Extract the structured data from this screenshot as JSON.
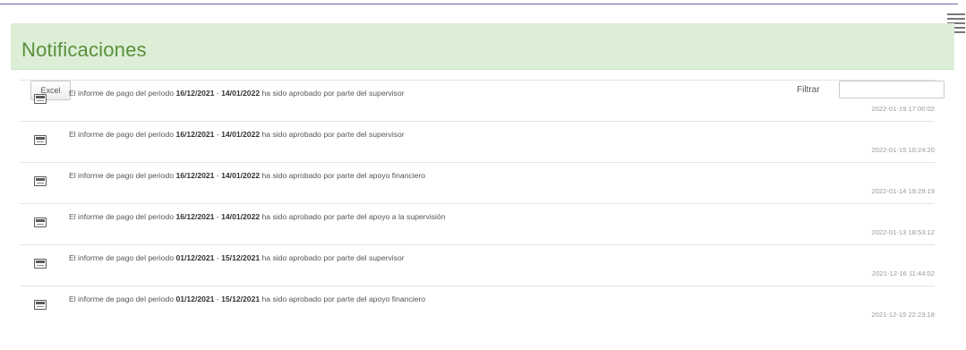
{
  "header": {
    "title": "Notificaciones",
    "menu_icon": "hamburger-menu-icon"
  },
  "toolbar": {
    "excel_label": "Excel",
    "filter_label": "Filtrar",
    "filter_value": ""
  },
  "notifications": [
    {
      "icon": "report-icon",
      "prefix": "El informe de pago del periodo",
      "start": "16/12/2021",
      "separator": "-",
      "end": "14/01/2022",
      "suffix": "ha sido aprobado por parte del supervisor",
      "timestamp": "2022-01-19 17:00:02"
    },
    {
      "icon": "report-icon",
      "prefix": "El informe de pago del periodo",
      "start": "16/12/2021",
      "separator": "-",
      "end": "14/01/2022",
      "suffix": "ha sido aprobado por parte del supervisor",
      "timestamp": "2022-01-15 10:24:20"
    },
    {
      "icon": "report-icon",
      "prefix": "El informe de pago del periodo",
      "start": "16/12/2021",
      "separator": "-",
      "end": "14/01/2022",
      "suffix": "ha sido aprobado por parte del apoyo financiero",
      "timestamp": "2022-01-14 19:29:19"
    },
    {
      "icon": "report-icon",
      "prefix": "El informe de pago del periodo",
      "start": "16/12/2021",
      "separator": "-",
      "end": "14/01/2022",
      "suffix": "ha sido aprobado por parte del apoyo a la supervisión",
      "timestamp": "2022-01-13 18:53:12"
    },
    {
      "icon": "report-icon",
      "prefix": "El informe de pago del periodo",
      "start": "01/12/2021",
      "separator": "-",
      "end": "15/12/2021",
      "suffix": "ha sido aprobado por parte del supervisor",
      "timestamp": "2021-12-16 11:44:02"
    },
    {
      "icon": "report-icon",
      "prefix": "El informe de pago del periodo",
      "start": "01/12/2021",
      "separator": "-",
      "end": "15/12/2021",
      "suffix": "ha sido aprobado por parte del apoyo financiero",
      "timestamp": "2021-12-15 22:23:18"
    }
  ],
  "colors": {
    "header_bg": "#dcefd6",
    "title": "#5a8f3c",
    "rule": "#6a64a8"
  }
}
